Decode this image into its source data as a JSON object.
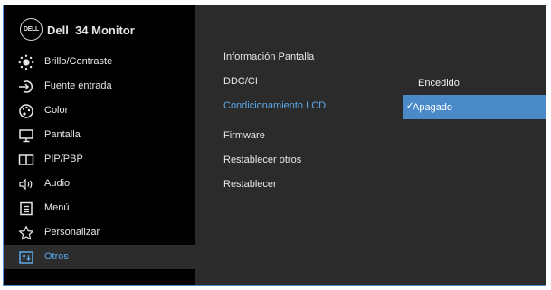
{
  "brand": {
    "logo_text": "DELL",
    "title": "Dell  34 Monitor"
  },
  "sidebar": {
    "items": [
      {
        "label": "Brillo/Contraste",
        "icon": "brightness-icon"
      },
      {
        "label": "Fuente entrada",
        "icon": "input-source-icon"
      },
      {
        "label": "Color",
        "icon": "color-palette-icon"
      },
      {
        "label": "Pantalla",
        "icon": "display-icon"
      },
      {
        "label": "PIP/PBP",
        "icon": "pip-pbp-icon"
      },
      {
        "label": "Audio",
        "icon": "speaker-icon"
      },
      {
        "label": "Menú",
        "icon": "menu-list-icon"
      },
      {
        "label": "Personalizar",
        "icon": "star-icon"
      },
      {
        "label": "Otros",
        "icon": "others-icon"
      }
    ],
    "selected": "Otros"
  },
  "submenu": {
    "items": [
      "Información Pantalla",
      "DDC/CI",
      "Condicionamiento LCD",
      "Firmware",
      "Restablecer otros",
      "Restablecer"
    ],
    "active": "Condicionamiento LCD"
  },
  "options": {
    "items": [
      "Encedido",
      "Apagado"
    ],
    "selected": "Apagado",
    "check_mark": "✓"
  },
  "colors": {
    "accent": "#5aa9ec",
    "selection": "#4b8ac9",
    "sidebar_bg": "#000000",
    "panel_bg": "#2b2b2b"
  }
}
